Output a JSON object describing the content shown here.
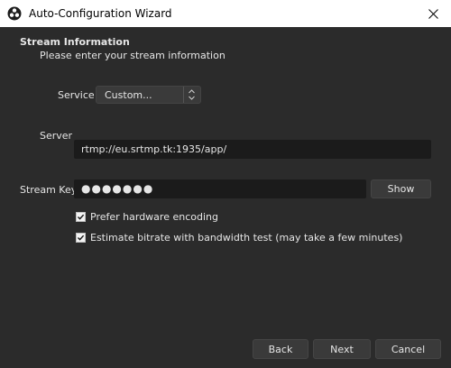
{
  "window": {
    "title": "Auto-Configuration Wizard",
    "close_icon": "close-icon",
    "app_icon": "obs-logo-icon"
  },
  "page": {
    "heading": "Stream Information",
    "subheading": "Please enter your stream information"
  },
  "service": {
    "label": "Service",
    "selected": "Custom..."
  },
  "server": {
    "label": "Server",
    "value": "rtmp://eu.srtmp.tk:1935/app/"
  },
  "stream_key": {
    "label": "Stream Key",
    "masked_value": "●●●●●●●",
    "show_label": "Show"
  },
  "options": [
    {
      "label": "Prefer hardware encoding",
      "checked": true
    },
    {
      "label": "Estimate bitrate with bandwidth test (may take a few minutes)",
      "checked": true
    }
  ],
  "footer": {
    "back_label": "Back",
    "next_label": "Next",
    "cancel_label": "Cancel"
  },
  "colors": {
    "background": "#2b2b2b",
    "input_background": "#1b1b1b",
    "button_background": "#3a3a3a",
    "text": "#e6e6e6"
  }
}
